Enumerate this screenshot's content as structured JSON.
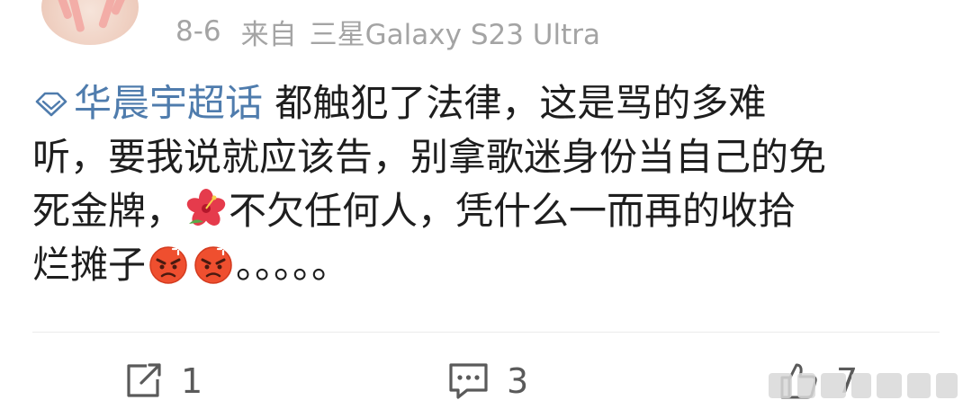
{
  "post": {
    "date": "8-6",
    "source_prefix": "来自",
    "device": "三星Galaxy S23 Ultra"
  },
  "comment": {
    "topic": "华晨宇超话",
    "lines": {
      "l1": "都触犯了法律，这是骂的多难",
      "l2": "听，要我说就应该告，别拿歌迷身份当自己的免",
      "l3a": "死金牌，",
      "l3b": "不欠任何人，凭什么一而再的收拾",
      "l4a": "烂摊子",
      "l4b": "。。。。。"
    },
    "emojis": [
      "hibiscus-emoji",
      "angry-face-emoji",
      "angry-face-emoji"
    ]
  },
  "actions": {
    "repost_count": "1",
    "comment_count": "3",
    "like_count": "7"
  },
  "icons": {
    "topic": "diamond-icon",
    "repost": "share-arrow-icon",
    "comment": "speech-bubble-icon",
    "like": "thumbs-up-icon"
  },
  "colors": {
    "topic_link": "#4f7cad",
    "meta_text": "#a4a4a4",
    "body_text": "#1e1e1e"
  }
}
